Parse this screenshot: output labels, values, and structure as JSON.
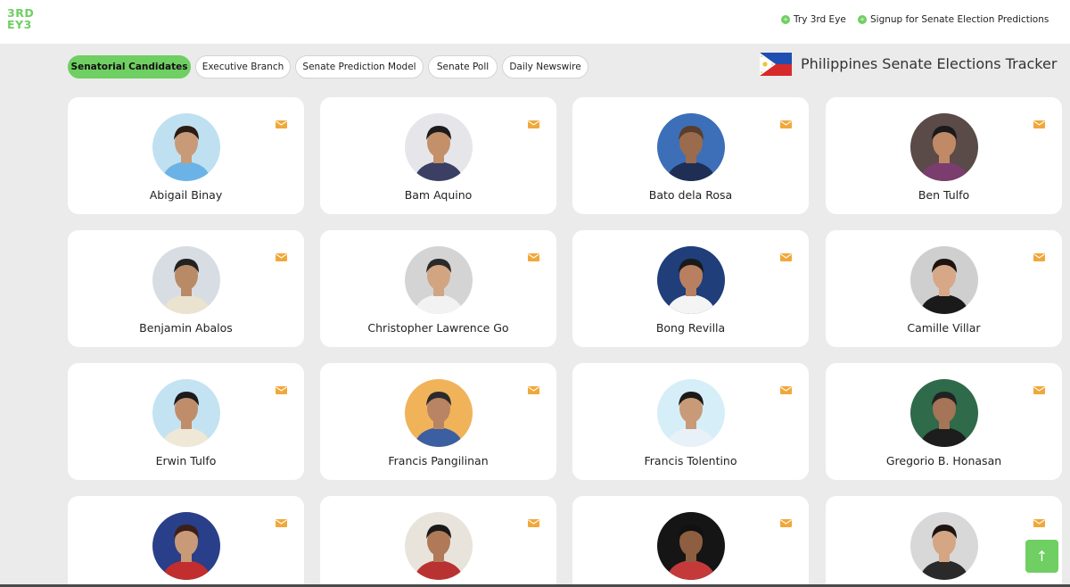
{
  "brand": {
    "logo_line1": "3RD",
    "logo_line2": "EY3",
    "color": "#6fcf62"
  },
  "header_links": [
    {
      "label": "Try 3rd Eye"
    },
    {
      "label": "Signup for Senate Election Predictions"
    }
  ],
  "tabs": [
    {
      "label": "Senatorial Candidates",
      "active": true
    },
    {
      "label": "Executive Branch",
      "active": false
    },
    {
      "label": "Senate Prediction Model",
      "active": false
    },
    {
      "label": "Senate Poll",
      "active": false
    },
    {
      "label": "Daily Newswire",
      "active": false
    }
  ],
  "tracker": {
    "title": "Philippines Senate Elections Tracker",
    "flag_icon": "philippines-flag-icon"
  },
  "candidates": [
    {
      "name": "Abigail Binay",
      "bg": "#bfe0f0",
      "skin": "#c99a78",
      "hair": "#2b1c14",
      "shirt": "#6bb3e6"
    },
    {
      "name": "Bam Aquino",
      "bg": "#e6e6ea",
      "skin": "#c3906a",
      "hair": "#1c1c1c",
      "shirt": "#3a3f63"
    },
    {
      "name": "Bato dela Rosa",
      "bg": "#3c6fb8",
      "skin": "#9a6b4c",
      "hair": "#5a3d2c",
      "shirt": "#1f2e55"
    },
    {
      "name": "Ben Tulfo",
      "bg": "#5a4a48",
      "skin": "#c08a66",
      "hair": "#1a1a1a",
      "shirt": "#7a3d6e"
    },
    {
      "name": "Benjamin Abalos",
      "bg": "#d8dde4",
      "skin": "#b98a66",
      "hair": "#222222",
      "shirt": "#e9e3cf"
    },
    {
      "name": "Christopher Lawrence Go",
      "bg": "#d4d4d4",
      "skin": "#d2a582",
      "hair": "#2a2a2a",
      "shirt": "#f2f2f2"
    },
    {
      "name": "Bong Revilla",
      "bg": "#1f3e7a",
      "skin": "#b88060",
      "hair": "#1a1a1a",
      "shirt": "#f4f4f4"
    },
    {
      "name": "Camille Villar",
      "bg": "#cfcfcf",
      "skin": "#d6a887",
      "hair": "#1d1410",
      "shirt": "#1a1a1a"
    },
    {
      "name": "Erwin Tulfo",
      "bg": "#c4e3f2",
      "skin": "#c08d6b",
      "hair": "#1b1b1b",
      "shirt": "#efe8d6"
    },
    {
      "name": "Francis Pangilinan",
      "bg": "#f0b35a",
      "skin": "#b98464",
      "hair": "#2b2b2b",
      "shirt": "#3b5fa0"
    },
    {
      "name": "Francis Tolentino",
      "bg": "#d6eef8",
      "skin": "#c99a78",
      "hair": "#1a1a1a",
      "shirt": "#e8f0f8"
    },
    {
      "name": "Gregorio B. Honasan",
      "bg": "#2f6a4a",
      "skin": "#a67456",
      "hair": "#222222",
      "shirt": "#1d1d1d"
    },
    {
      "name": "",
      "bg": "#2a3f8a",
      "skin": "#c99a78",
      "hair": "#3a2018",
      "shirt": "#c22d2d"
    },
    {
      "name": "",
      "bg": "#e8e4dc",
      "skin": "#b07a58",
      "hair": "#1a1a1a",
      "shirt": "#b83232"
    },
    {
      "name": "",
      "bg": "#151515",
      "skin": "#8e5e40",
      "hair": "#111111",
      "shirt": "#c43a3a"
    },
    {
      "name": "",
      "bg": "#d8d8d8",
      "skin": "#d4a684",
      "hair": "#1e1410",
      "shirt": "#2a2a2a"
    }
  ],
  "scroll_top_icon": "arrow-up-icon"
}
